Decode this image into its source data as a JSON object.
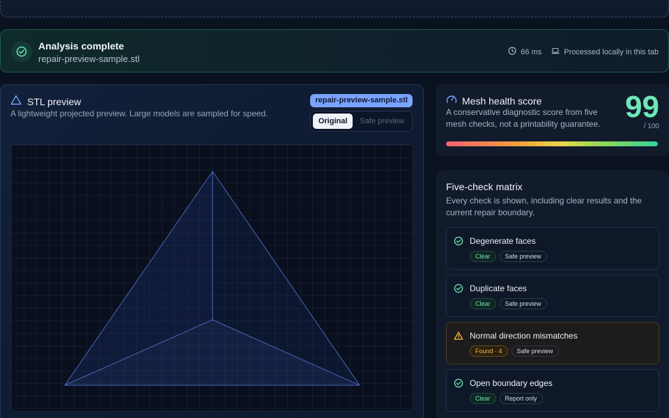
{
  "status": {
    "title": "Analysis complete",
    "file": "repair-preview-sample.stl",
    "duration": "66 ms",
    "processing": "Processed locally in this tab"
  },
  "preview": {
    "title": "STL preview",
    "subtitle": "A lightweight projected preview. Large models are sampled for speed.",
    "file_badge": "repair-preview-sample.stl",
    "toggle_original": "Original",
    "toggle_safe": "Safe preview"
  },
  "score": {
    "title": "Mesh health score",
    "description": "A conservative diagnostic score from five mesh checks, not a printability guarantee.",
    "value": "99",
    "max": "/ 100"
  },
  "matrix": {
    "title": "Five-check matrix",
    "description": "Every check is shown, including clear results and the current repair boundary.",
    "checks": [
      {
        "name": "Degenerate faces",
        "status": "Clear",
        "scope": "Safe preview"
      },
      {
        "name": "Duplicate faces",
        "status": "Clear",
        "scope": "Safe preview"
      },
      {
        "name": "Normal direction mismatches",
        "status": "Found · 4",
        "scope": "Safe preview"
      },
      {
        "name": "Open boundary edges",
        "status": "Clear",
        "scope": "Report only"
      }
    ]
  },
  "colors": {
    "accent_green": "#6ee7b7",
    "accent_blue": "#7aa2ff",
    "warning": "#f5b54a"
  },
  "icons": {
    "status": "check-circle-icon",
    "duration": "clock-icon",
    "processing": "laptop-icon",
    "preview": "triangle-icon",
    "score": "gauge-icon",
    "check_clear": "check-circle-icon",
    "check_warning": "warning-triangle-icon"
  }
}
